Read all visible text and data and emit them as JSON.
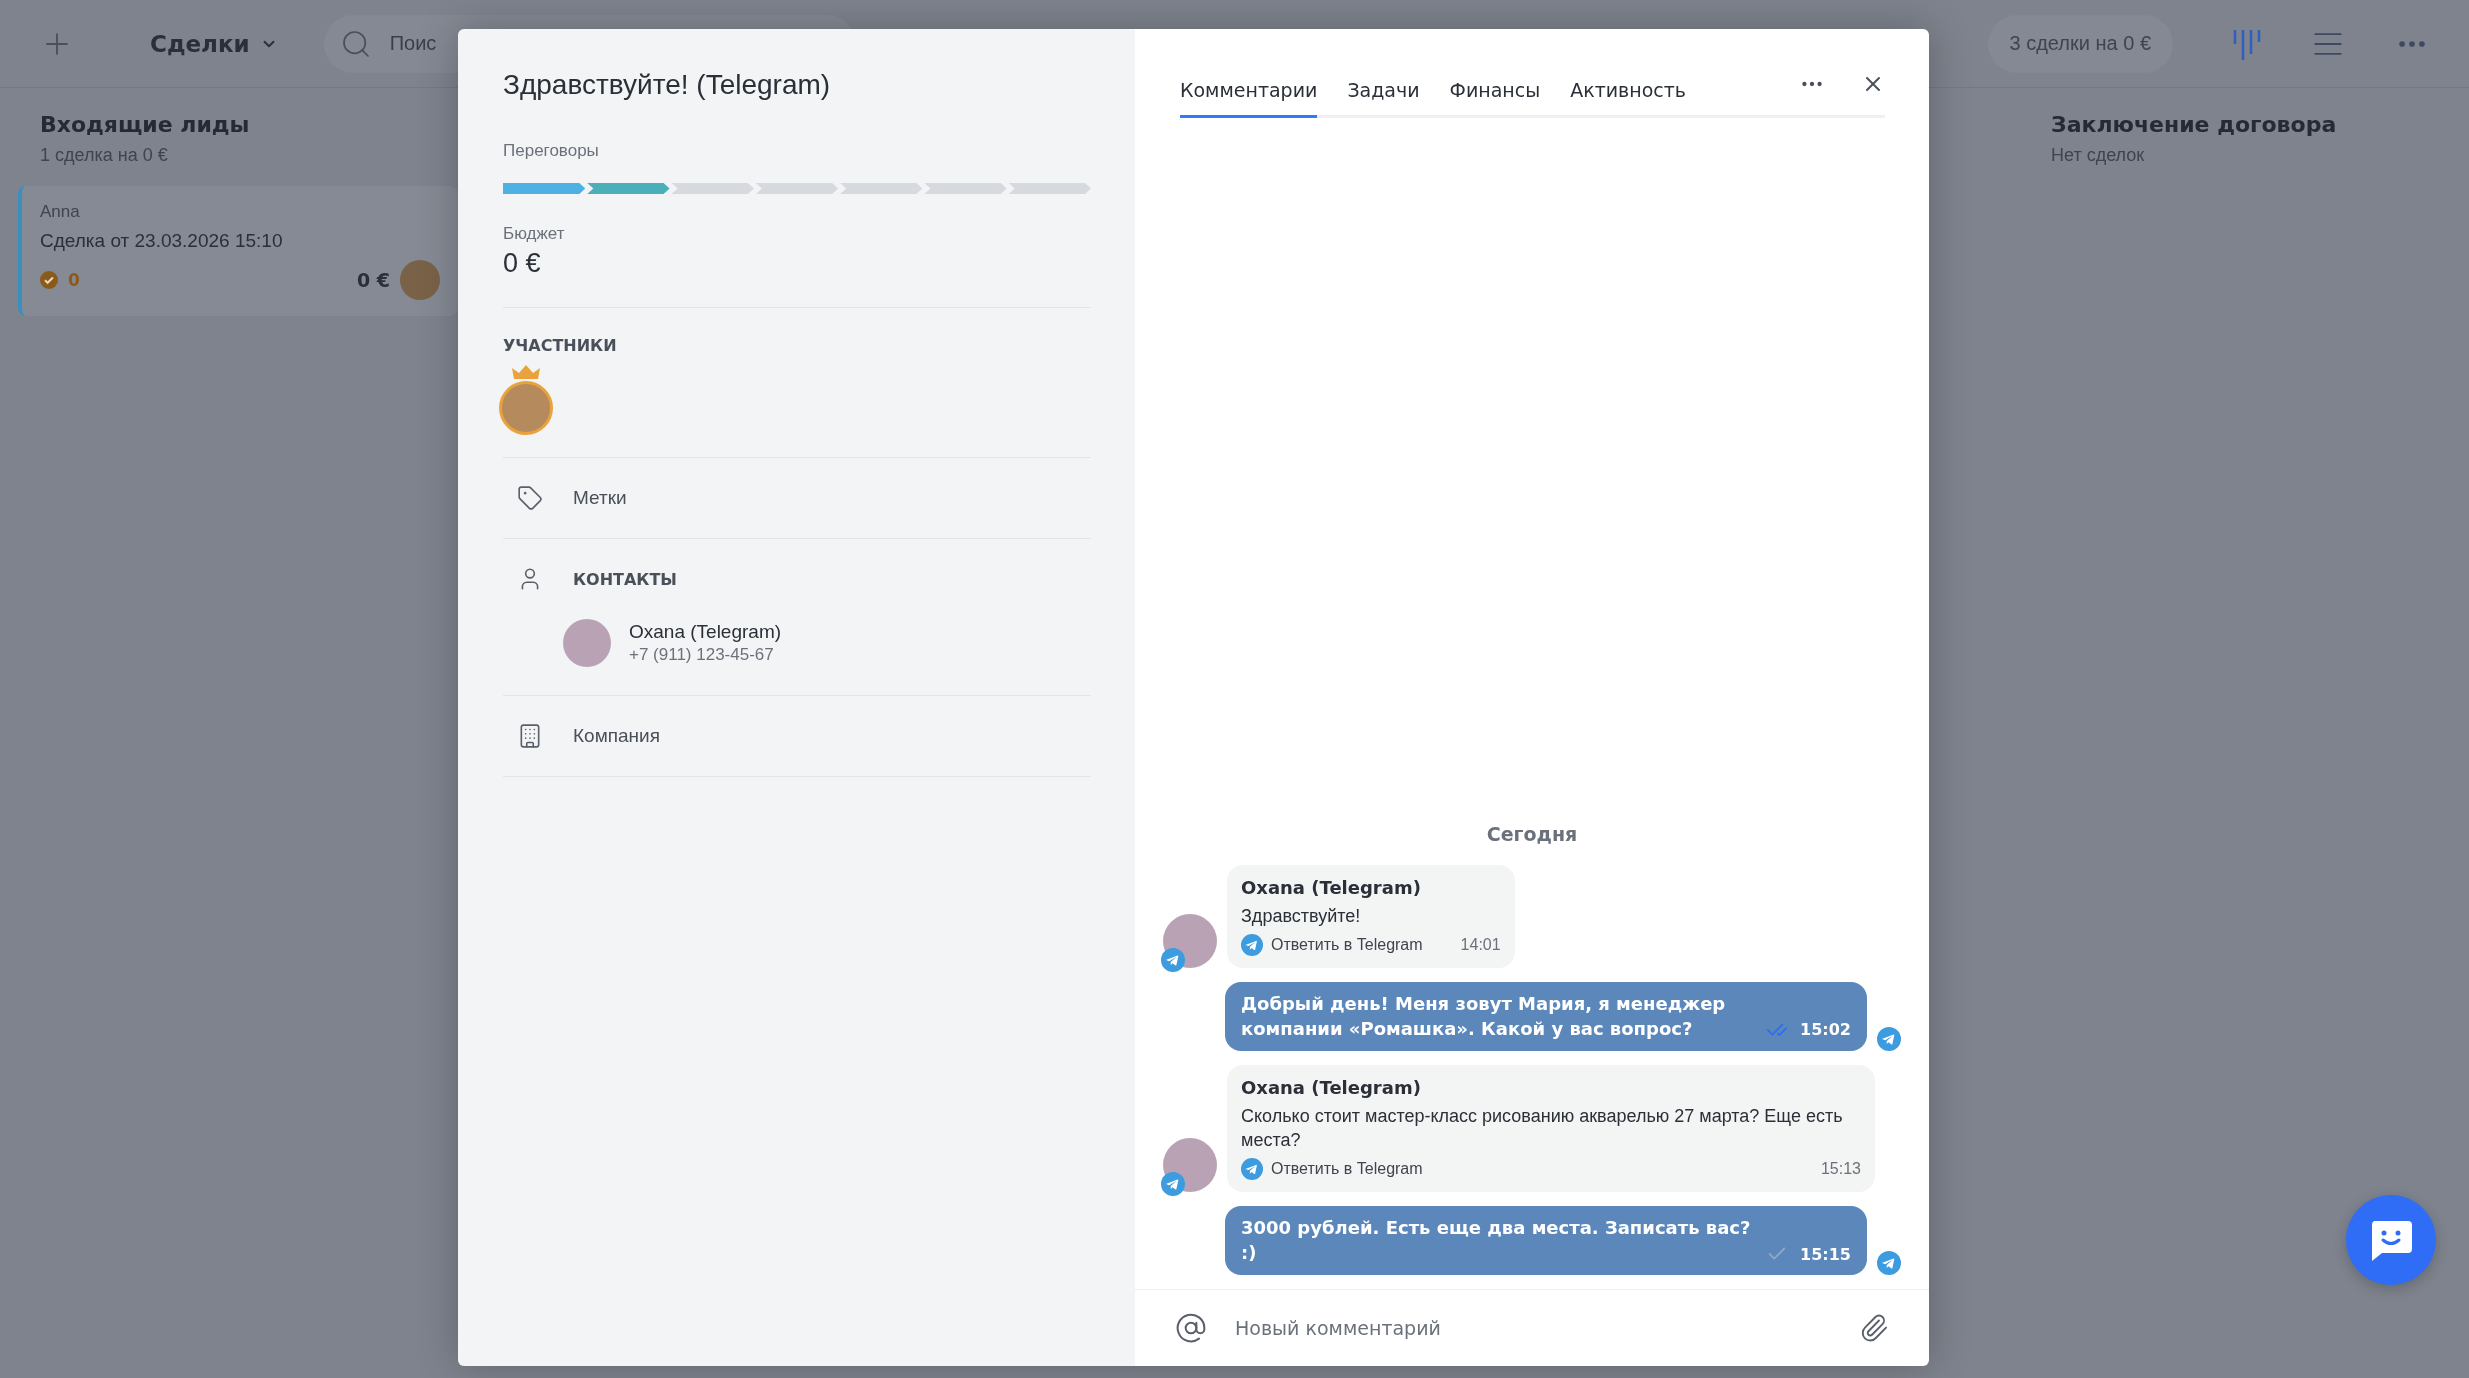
{
  "topbar": {
    "section": "Сделки",
    "search_placeholder": "Поис",
    "summary": "3 сделки на 0 €"
  },
  "columns": [
    {
      "title": "Входящие лиды",
      "subtitle": "1 сделка на 0 €",
      "cards": [
        {
          "contact": "Anna",
          "title": "Сделка от 23.03.2026 15:10",
          "tasks": "0",
          "amount": "0 €"
        }
      ]
    },
    {
      "title": "Заключение договора",
      "subtitle": "Нет сделок"
    }
  ],
  "deal": {
    "title": "Здравствуйте! (Telegram)",
    "stage": "Переговоры",
    "stages": [
      {
        "color": "#4fb0e3"
      },
      {
        "color": "#4aafb9"
      },
      {
        "color": "#d6d9de"
      },
      {
        "color": "#d6d9de"
      },
      {
        "color": "#d6d9de"
      },
      {
        "color": "#d6d9de"
      },
      {
        "color": "#d6d9de"
      }
    ],
    "budget_label": "Бюджет",
    "budget": "0 €",
    "participants_label": "УЧАСТНИКИ",
    "tags_label": "Метки",
    "contacts_label": "КОНТАКТЫ",
    "contacts": [
      {
        "name": "Oxana (Telegram)",
        "phone": "+7 (911) 123-45-67"
      }
    ],
    "company_label": "Компания"
  },
  "tabs": [
    {
      "label": "Комментарии",
      "selected": true
    },
    {
      "label": "Задачи",
      "selected": false
    },
    {
      "label": "Финансы",
      "selected": false
    },
    {
      "label": "Активность",
      "selected": false
    }
  ],
  "chat": {
    "date": "Сегодня",
    "messages": [
      {
        "kind": "incoming",
        "author": "Oxana (Telegram)",
        "text": "Здравствуйте!",
        "reply": "Ответить в Telegram",
        "time": "14:01"
      },
      {
        "kind": "outgoing",
        "text": "Добрый день! Меня зовут Мария, я менеджер компании «Ромашка». Какой у вас вопрос?",
        "time": "15:02",
        "read": true
      },
      {
        "kind": "incoming",
        "author": "Oxana (Telegram)",
        "text": "Сколько стоит мастер-класс рисованию акварелью 27 марта? Еще есть места?",
        "reply": "Ответить в Telegram",
        "time": "15:13"
      },
      {
        "kind": "outgoing",
        "text": "3000 рублей. Есть еще два места. Записать вас? :)",
        "time": "15:15",
        "read": false
      }
    ],
    "input_placeholder": "Новый комментарий"
  }
}
